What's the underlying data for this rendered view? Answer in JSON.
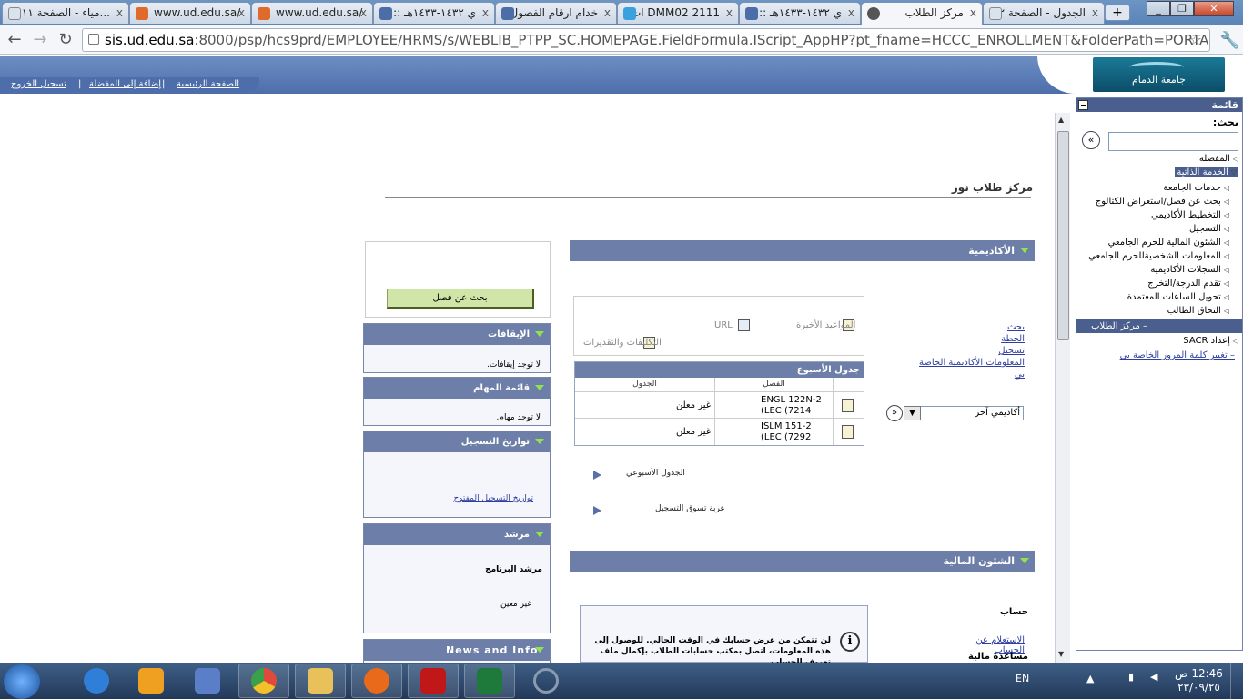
{
  "browser": {
    "tabs": [
      {
        "title": "...مياء - الصفحة ١١",
        "icon_color": "#d9e3ee",
        "active": false
      },
      {
        "title": "www.ud.edu.sa/",
        "icon_color": "#e06a2c",
        "active": false
      },
      {
        "title": "www.ud.edu.sa/",
        "icon_color": "#e06a2c",
        "active": false
      },
      {
        "title": "ي ١٤٣٢-١٤٣٣هـ ::",
        "icon_color": "#4c6ea8",
        "active": false
      },
      {
        "title": "خدام ارقام الفصول",
        "icon_color": "#4c6ea8",
        "active": false
      },
      {
        "title": "DMM02 2111 ات",
        "icon_color": "#3aa0e0",
        "active": false
      },
      {
        "title": "ي ١٤٣٢-١٤٣٣هـ ::",
        "icon_color": "#4c6ea8",
        "active": false
      },
      {
        "title": "مركز الطلاب",
        "icon_color": "#555555",
        "active": true
      },
      {
        "title": "الجدول - الصفحة ٢",
        "icon_color": "#d9e3ee",
        "active": false
      }
    ],
    "new_tab_label": "+",
    "url_host": "sis.ud.edu.sa",
    "url_rest": ":8000/psp/hcs9prd/EMPLOYEE/HRMS/s/WEBLIB_PTPP_SC.HOMEPAGE.FieldFormula.IScript_AppHP?pt_fname=HCCC_ENROLLMENT&FolderPath=PORTAL_ROOT_OBJECT"
  },
  "header": {
    "logo_text": "جامعة الدمام",
    "links": {
      "logout": "تسجيل الخروج",
      "add_favorite": "إضافة إلى المفضلة",
      "home": "الصفحة الرئيسية"
    }
  },
  "menu": {
    "title": "قائمة",
    "search_label": "بحث:",
    "go": "»",
    "favorites": "المفضلة",
    "self_service": "الخدمة الذاتية",
    "items": [
      "خدمات الجامعة",
      "بحث عن فصل/استعراض الكتالوج",
      "التخطيط الأكاديمي",
      "التسجيل",
      "الشئون المالية للحرم الجامعي",
      "المعلومات الشخصيةللحرم الجامعي",
      "السجلات الأكاديمية",
      "تقدم الدرجة/التخرج",
      "تحويل الساعات المعتمدة",
      "التحاق الطالب"
    ],
    "active_item": "– مركز الطلاب",
    "sacr": "إعداد SACR",
    "change_password": "– تغيير كلمة المرور الخاصة بي"
  },
  "main": {
    "page_title": "مركز طلاب نور",
    "academic": {
      "title": "الأكاديمية",
      "links": [
        "بحث",
        "الخطة",
        "تسجيل",
        "المعلومات الأكاديمية الخاصة بي"
      ],
      "select_value": "أكاديمي آخر",
      "go": "»",
      "quick": {
        "deadlines": "المواعيد الأخيرة",
        "url": "URL",
        "assignments": "التكليفات والتقديرات"
      },
      "week_table": {
        "title": "جدول الأسبوع",
        "col_class": "الفصل",
        "col_schedule": "الجدول",
        "rows": [
          {
            "class_line1": "ENGL 122N-2",
            "class_line2": "(LEC (7214",
            "schedule": "غير معلن"
          },
          {
            "class_line1": "ISLM 151-2",
            "class_line2": "(LEC (7292",
            "schedule": "غير معلن"
          }
        ]
      },
      "weekly_schedule": "الجدول الأسبوعي",
      "shopping_cart": "عربة تسوق التسجيل"
    },
    "finance": {
      "title": "الشئون المالية",
      "account": "حساب",
      "account_inquiry": "الاستعلام عن الحساب",
      "financial_aid": "مساعدة مالية",
      "info_icon": "i",
      "info_text": "لن تتمكن من عرض حسابك في الوقت الحالي. للوصول إلى هذه المعلومات، اتصل بمكتب حسابات الطلاب بإكمال ملف تعريف الحساب."
    }
  },
  "sidebar": {
    "search_button": "بحث عن فصل",
    "holds": {
      "title": "الإيقافات",
      "body": "لا توجد إيقافات."
    },
    "todo": {
      "title": "قائمة المهام",
      "body": "لا توجد مهام."
    },
    "enrollment_dates": {
      "title": "تواريخ التسجيل",
      "link": "تواريخ التسجيل المفتوح"
    },
    "advisor": {
      "title": "مرشد",
      "label": "مرشد البرنامج",
      "value": "غير معين"
    },
    "news": {
      "title": "News and Info"
    }
  },
  "taskbar": {
    "lang": "EN",
    "time": "12:46 ص",
    "date": "٢٣/٠٩/٢٥",
    "apps": [
      {
        "name": "ie",
        "color": "#2f7fd8"
      },
      {
        "name": "media",
        "color": "#f0a020"
      },
      {
        "name": "tool",
        "color": "#5b7ec8"
      },
      {
        "name": "chrome",
        "color": "#e04a3a"
      },
      {
        "name": "explorer",
        "color": "#e8c15a"
      },
      {
        "name": "firefox",
        "color": "#e86a1a"
      },
      {
        "name": "acrobat",
        "color": "#c01818"
      },
      {
        "name": "excel",
        "color": "#1e7a3a"
      },
      {
        "name": "loading",
        "color": "#8a9ab0"
      }
    ]
  }
}
